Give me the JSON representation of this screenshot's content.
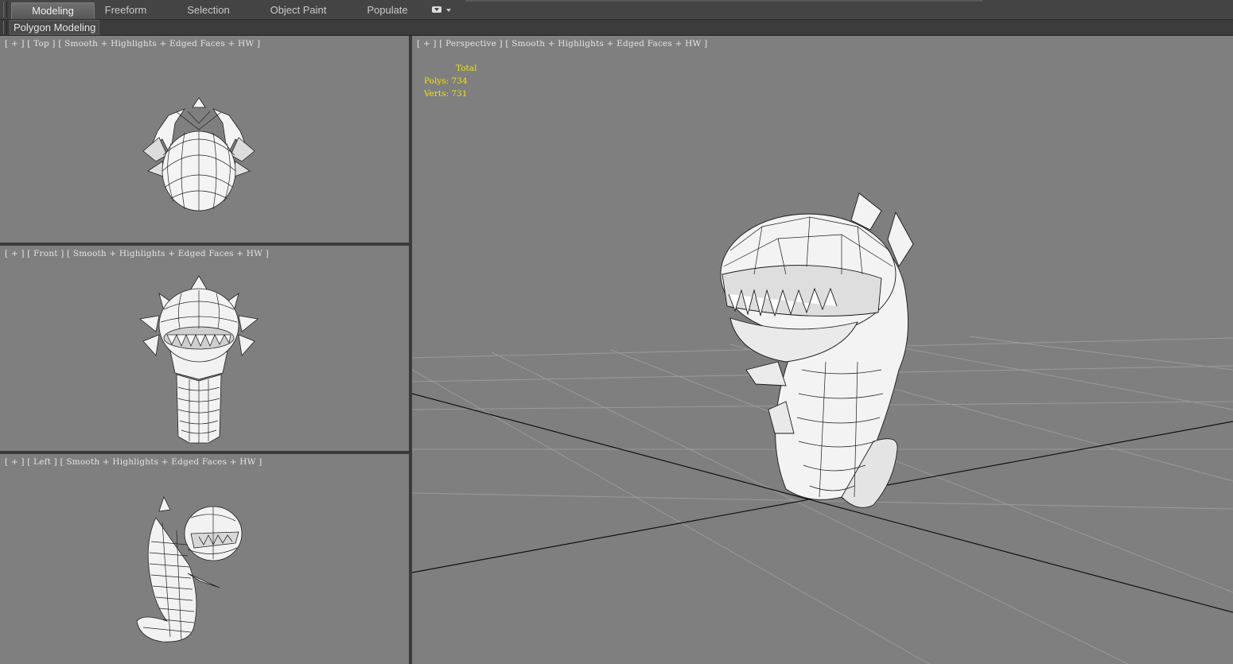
{
  "ribbon": {
    "tabs": [
      {
        "label": "Modeling",
        "active": true
      },
      {
        "label": "Freeform",
        "active": false
      },
      {
        "label": "Selection",
        "active": false
      },
      {
        "label": "Object Paint",
        "active": false
      },
      {
        "label": "Populate",
        "active": false
      }
    ],
    "panel_label": "Polygon Modeling",
    "dropdown_icon": "ribbon-options-icon"
  },
  "viewports": {
    "top": {
      "plus": "[ + ]",
      "name": "[ Top ]",
      "shading": "[ Smooth + Highlights + Edged Faces + HW ]"
    },
    "front": {
      "plus": "[ + ]",
      "name": "[ Front ]",
      "shading": "[ Smooth + Highlights + Edged Faces + HW ]"
    },
    "left": {
      "plus": "[ + ]",
      "name": "[ Left ]",
      "shading": "[ Smooth + Highlights + Edged Faces + HW ]"
    },
    "perspective": {
      "plus": "[ + ]",
      "name": "[ Perspective ]",
      "shading": "[ Smooth + Highlights + Edged Faces + HW ]"
    }
  },
  "stats": {
    "title": "Total",
    "polys_label": "Polys:",
    "polys_value": "734",
    "verts_label": "Verts:",
    "verts_value": "731"
  },
  "colors": {
    "viewport_bg": "#7f7f7f",
    "stats_text": "#f2e400",
    "ribbon_bg": "#444444"
  }
}
